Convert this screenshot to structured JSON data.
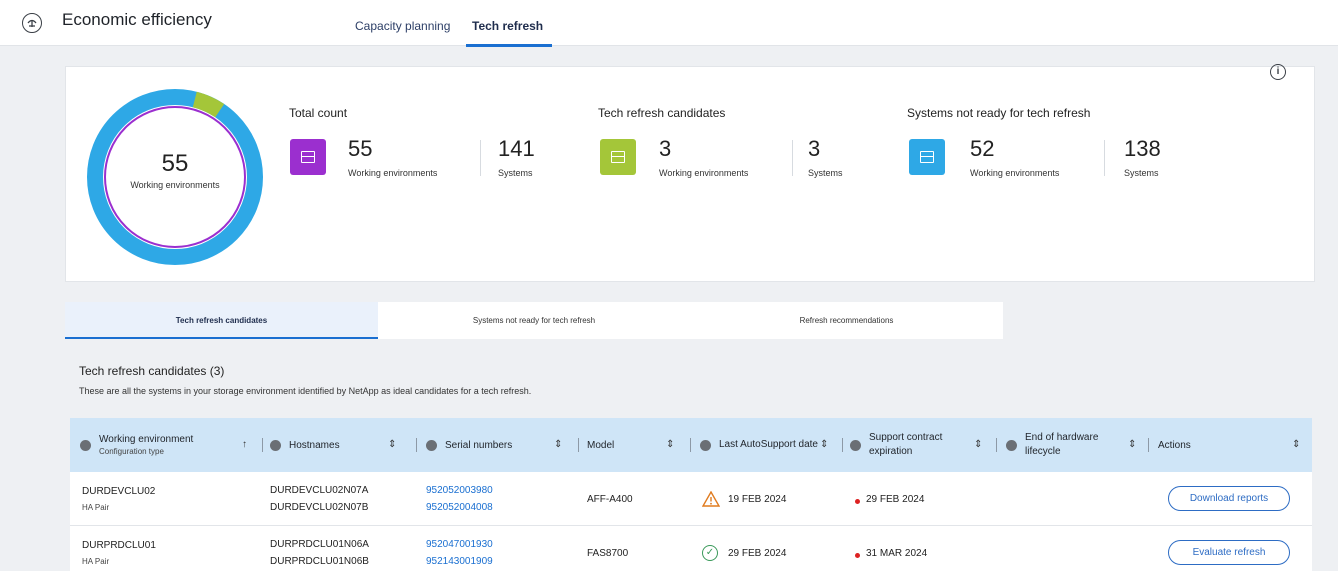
{
  "app": {
    "title": "Economic efficiency",
    "icon": "app-logo-icon"
  },
  "top_tabs": [
    {
      "label": "Capacity planning",
      "active": false
    },
    {
      "label": "Tech refresh",
      "active": true
    }
  ],
  "summary": {
    "donut": {
      "value": "55",
      "label": "Working environments",
      "segments": [
        {
          "name": "Tech refresh candidates",
          "value": 3,
          "color": "#a4c639"
        },
        {
          "name": "Systems not ready for tech refresh",
          "value": 52,
          "color": "#2ea8e6"
        }
      ]
    },
    "stats": [
      {
        "title": "Total count",
        "color": "#9b2fcf",
        "we_value": "55",
        "we_label": "Working environments",
        "sys_value": "141",
        "sys_label": "Systems"
      },
      {
        "title": "Tech refresh candidates",
        "color": "#a4c639",
        "we_value": "3",
        "we_label": "Working environments",
        "sys_value": "3",
        "sys_label": "Systems"
      },
      {
        "title": "Systems not ready for tech refresh",
        "color": "#2ea8e6",
        "we_value": "52",
        "we_label": "Working environments",
        "sys_value": "138",
        "sys_label": "Systems"
      }
    ]
  },
  "sub_tabs": [
    {
      "label": "Tech refresh candidates",
      "active": true
    },
    {
      "label": "Systems not ready for tech refresh",
      "active": false
    },
    {
      "label": "Refresh recommendations",
      "active": false
    }
  ],
  "section": {
    "title": "Tech refresh candidates (3)",
    "description": "These are all the systems in your storage environment identified by NetApp as ideal candidates for a tech refresh."
  },
  "table": {
    "headers": {
      "working_environment": "Working environment",
      "configuration_type": "Configuration type",
      "hostnames": "Hostnames",
      "serial_numbers": "Serial numbers",
      "model": "Model",
      "last_autosupport": "Last AutoSupport date",
      "support_contract": "Support contract expiration",
      "end_of_hardware": "End of hardware lifecycle",
      "actions": "Actions"
    },
    "rows": [
      {
        "name": "DURDEVCLU02",
        "config": "HA Pair",
        "host1": "DURDEVCLU02N07A",
        "host2": "DURDEVCLU02N07B",
        "serial1": "952052003980",
        "serial2": "952052004008",
        "model": "AFF-A400",
        "autosupport": "19 FEB 2024",
        "autosupport_status": "warning",
        "contract": "29 FEB 2024",
        "action": "Download reports"
      },
      {
        "name": "DURPRDCLU01",
        "config": "HA Pair",
        "host1": "DURPRDCLU01N06A",
        "host2": "DURPRDCLU01N06B",
        "serial1": "952047001930",
        "serial2": "952143001909",
        "model": "FAS8700",
        "autosupport": "29 FEB 2024",
        "autosupport_status": "ok",
        "contract": "31 MAR 2024",
        "action": "Evaluate refresh"
      }
    ]
  }
}
